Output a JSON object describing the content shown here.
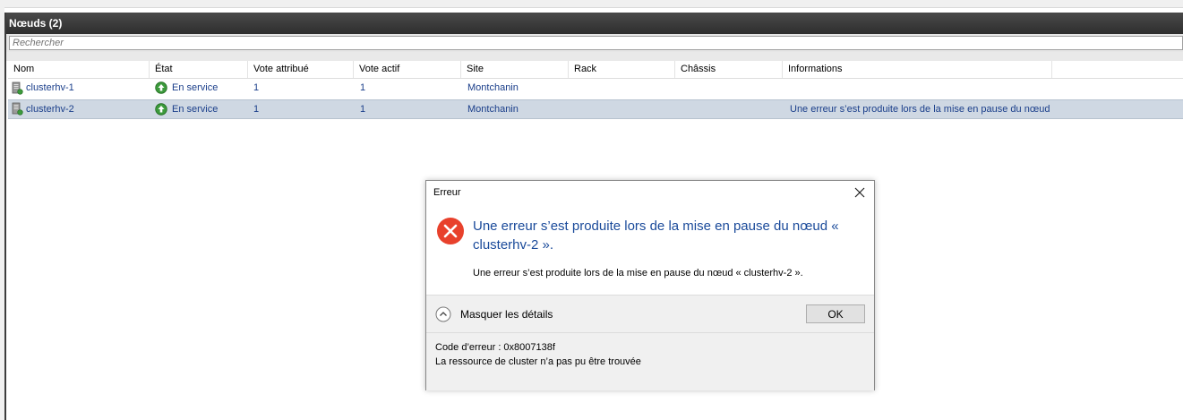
{
  "panel": {
    "title": "Nœuds (2)",
    "search_placeholder": "Rechercher"
  },
  "columns": [
    "Nom",
    "État",
    "Vote attribué",
    "Vote actif",
    "Site",
    "Rack",
    "Châssis",
    "Informations"
  ],
  "rows": [
    {
      "name": "clusterhv-1",
      "state": "En service",
      "vote_assigned": "1",
      "vote_active": "1",
      "site": "Montchanin",
      "rack": "",
      "chassis": "",
      "info": ""
    },
    {
      "name": "clusterhv-2",
      "state": "En service",
      "vote_assigned": "1",
      "vote_active": "1",
      "site": "Montchanin",
      "rack": "",
      "chassis": "",
      "info": "Une erreur s’est produite lors de la mise en pause du nœud"
    }
  ],
  "dialog": {
    "title": "Erreur",
    "main_instruction": "Une erreur s’est produite lors de la mise en pause du nœud « clusterhv-2 ».",
    "content": "Une erreur s’est produite lors de la mise en pause du nœud « clusterhv-2 ».",
    "details_toggle": "Masquer les détails",
    "ok_label": "OK",
    "error_code": "Code d’erreur : 0x8007138f",
    "error_message": "La ressource de cluster n’a pas pu être trouvée"
  },
  "colors": {
    "link_text": "#1a3e8a",
    "selected_row": "#cfd8e3",
    "header_bar": "#3a3a3a",
    "error_red": "#e8412c",
    "status_green": "#3c9a3c"
  },
  "icons": {
    "node": "server-node-icon",
    "status": "status-up-arrow-icon",
    "error": "error-x-icon",
    "close": "close-icon",
    "toggle": "chevron-up-icon"
  }
}
